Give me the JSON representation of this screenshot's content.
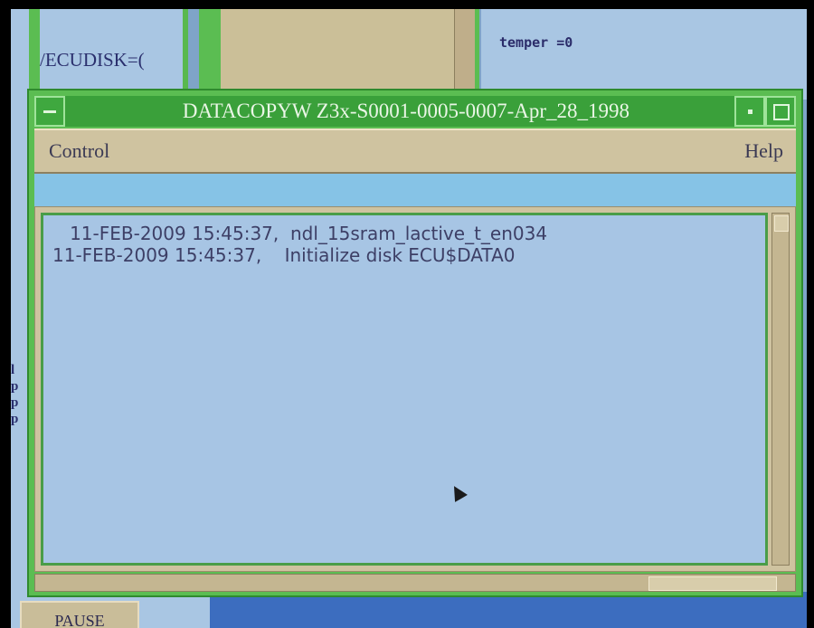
{
  "background": {
    "left_window_text": "/ECUDISK=(",
    "right_window_text": "temper =0",
    "left_letters": "l\np\np\np",
    "pause_button_label": "PAUSE"
  },
  "window": {
    "title": "DATACOPYW Z3x-S0001-0005-0007-Apr_28_1998",
    "menu": {
      "control_label": "Control",
      "help_label": "Help"
    },
    "log_lines": [
      "   11-FEB-2009 15:45:37,  ndl_15sram_lactive_t_en034",
      "11-FEB-2009 15:45:37,    Initialize disk ECU$DATA0"
    ]
  },
  "colors": {
    "window_frame": "#5bbd52",
    "menubar": "#cfc3a0",
    "log_background": "#a7c5e4",
    "status_strip": "#86c3e6"
  },
  "icons": {
    "window_menu": "window-menu-icon",
    "minimize": "minimize-icon",
    "maximize": "maximize-icon",
    "pointer": "mouse-pointer-icon"
  }
}
